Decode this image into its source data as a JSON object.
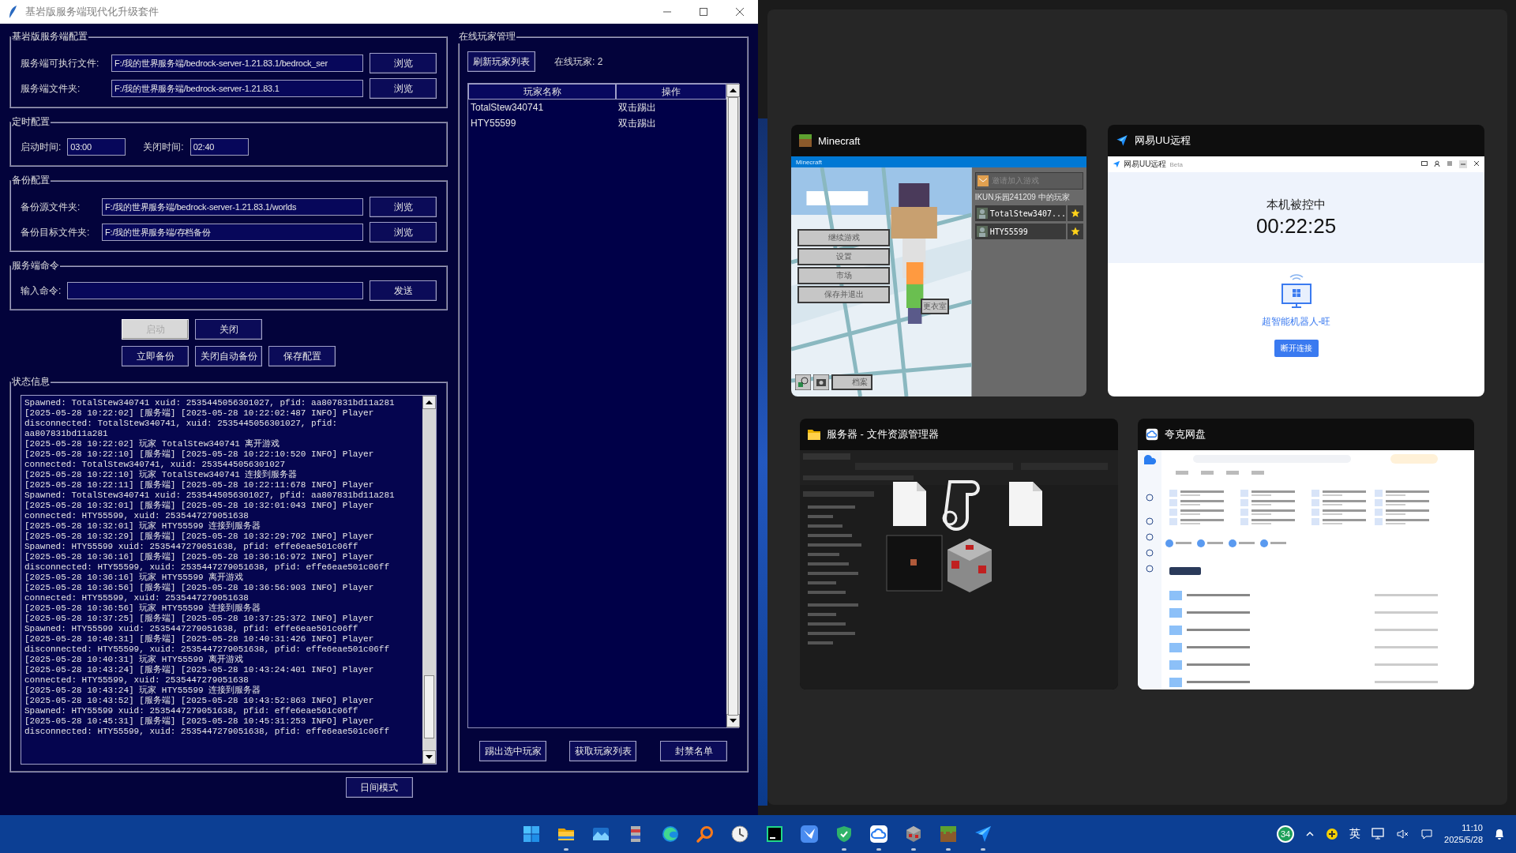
{
  "app_window": {
    "title": "基岩版服务端现代化升级套件",
    "server_config": {
      "title": "基岩版服务端配置",
      "fields": [
        {
          "label": "服务端可执行文件:",
          "value": "F:/我的世界服务端/bedrock-server-1.21.83.1/bedrock_ser",
          "button": "浏览"
        },
        {
          "label": "服务端文件夹:",
          "value": "F:/我的世界服务端/bedrock-server-1.21.83.1",
          "button": "浏览"
        }
      ]
    },
    "schedule": {
      "title": "定时配置",
      "fields": [
        {
          "label": "启动时间:",
          "value": "03:00"
        },
        {
          "label": "关闭时间:",
          "value": "02:40"
        }
      ]
    },
    "backup": {
      "title": "备份配置",
      "fields": [
        {
          "label": "备份源文件夹:",
          "value": "F:/我的世界服务端/bedrock-server-1.21.83.1/worlds",
          "button": "浏览"
        },
        {
          "label": "备份目标文件夹:",
          "value": "F:/我的世界服务端/存档备份",
          "button": "浏览"
        }
      ]
    },
    "command": {
      "title": "服务端命令",
      "label": "输入命令:",
      "button": "发送"
    },
    "actions": [
      {
        "label": "启动",
        "disabled": true
      },
      {
        "label": "关闭",
        "disabled": false
      },
      {
        "label": "立即备份",
        "disabled": false
      },
      {
        "label": "关闭自动备份",
        "disabled": false
      },
      {
        "label": "保存配置",
        "disabled": false
      }
    ],
    "status": {
      "title": "状态信息",
      "log": [
        "Spawned: TotalStew340741 xuid: 2535445056301027, pfid: aa807831bd11a281",
        "[2025-05-28 10:22:02] [服务端] [2025-05-28 10:22:02:487 INFO] Player",
        "disconnected: TotalStew340741, xuid: 2535445056301027, pfid:",
        "aa807831bd11a281",
        "[2025-05-28 10:22:02] 玩家 TotalStew340741 离开游戏",
        "[2025-05-28 10:22:10] [服务端] [2025-05-28 10:22:10:520 INFO] Player",
        "connected: TotalStew340741, xuid: 2535445056301027",
        "[2025-05-28 10:22:10] 玩家 TotalStew340741 连接到服务器",
        "[2025-05-28 10:22:11] [服务端] [2025-05-28 10:22:11:678 INFO] Player",
        "Spawned: TotalStew340741 xuid: 2535445056301027, pfid: aa807831bd11a281",
        "[2025-05-28 10:32:01] [服务端] [2025-05-28 10:32:01:043 INFO] Player",
        "connected: HTY55599, xuid: 2535447279051638",
        "[2025-05-28 10:32:01] 玩家 HTY55599 连接到服务器",
        "[2025-05-28 10:32:29] [服务端] [2025-05-28 10:32:29:702 INFO] Player",
        "Spawned: HTY55599 xuid: 2535447279051638, pfid: effe6eae501c06ff",
        "[2025-05-28 10:36:16] [服务端] [2025-05-28 10:36:16:972 INFO] Player",
        "disconnected: HTY55599, xuid: 2535447279051638, pfid: effe6eae501c06ff",
        "[2025-05-28 10:36:16] 玩家 HTY55599 离开游戏",
        "[2025-05-28 10:36:56] [服务端] [2025-05-28 10:36:56:903 INFO] Player",
        "connected: HTY55599, xuid: 2535447279051638",
        "[2025-05-28 10:36:56] 玩家 HTY55599 连接到服务器",
        "[2025-05-28 10:37:25] [服务端] [2025-05-28 10:37:25:372 INFO] Player",
        "Spawned: HTY55599 xuid: 2535447279051638, pfid: effe6eae501c06ff",
        "[2025-05-28 10:40:31] [服务端] [2025-05-28 10:40:31:426 INFO] Player",
        "disconnected: HTY55599, xuid: 2535447279051638, pfid: effe6eae501c06ff",
        "[2025-05-28 10:40:31] 玩家 HTY55599 离开游戏",
        "[2025-05-28 10:43:24] [服务端] [2025-05-28 10:43:24:401 INFO] Player",
        "connected: HTY55599, xuid: 2535447279051638",
        "[2025-05-28 10:43:24] 玩家 HTY55599 连接到服务器",
        "[2025-05-28 10:43:52] [服务端] [2025-05-28 10:43:52:863 INFO] Player",
        "Spawned: HTY55599 xuid: 2535447279051638, pfid: effe6eae501c06ff",
        "[2025-05-28 10:45:31] [服务端] [2025-05-28 10:45:31:253 INFO] Player",
        "disconnected: HTY55599, xuid: 2535447279051638, pfid: effe6eae501c06ff"
      ]
    },
    "theme_button": "日间模式",
    "players": {
      "title": "在线玩家管理",
      "refresh_button": "刷新玩家列表",
      "count": "在线玩家: 2",
      "columns": [
        "玩家名称",
        "操作"
      ],
      "rows": [
        {
          "name": "TotalStew340741",
          "action": "双击踢出",
          "selected": false
        },
        {
          "name": "HTY55599",
          "action": "双击踢出",
          "selected": false
        }
      ],
      "buttons": [
        "踢出选中玩家",
        "获取玩家列表",
        "封禁名单"
      ]
    }
  },
  "task_view": {
    "windows": [
      {
        "kind": "game",
        "title": "Minecraft",
        "bar_title": "Minecraft",
        "menu": [
          "继续游戏",
          "设置",
          "市场",
          "保存并退出"
        ],
        "wardrobe": "更衣室",
        "profile": "档案",
        "invite": "邀请加入游戏",
        "list_title": "IKUN乐园241209 中的玩家",
        "players": [
          "TotalStew3407...",
          "HTY55599"
        ]
      },
      {
        "kind": "remote",
        "title": "网易UU远程",
        "bar_title": "网易UU远程",
        "bar_badge": "Beta",
        "status": "本机被控中",
        "timer": "00:22:25",
        "device": "超智能机器人-旺",
        "button": "断开连接"
      },
      {
        "kind": "explorer",
        "title": "服务器 - 文件资源管理器"
      },
      {
        "kind": "cloud_drive",
        "title": "夸克网盘"
      }
    ]
  },
  "taskbar": {
    "apps": [
      {
        "kind": "start",
        "running": false
      },
      {
        "kind": "folder",
        "running": true
      },
      {
        "kind": "photos",
        "running": false
      },
      {
        "kind": "archive",
        "running": false
      },
      {
        "kind": "browser",
        "running": false
      },
      {
        "kind": "search",
        "running": false
      },
      {
        "kind": "clock",
        "running": false
      },
      {
        "kind": "ide",
        "running": false
      },
      {
        "kind": "bird",
        "running": false
      },
      {
        "kind": "shield",
        "running": true
      },
      {
        "kind": "cloud",
        "running": true
      },
      {
        "kind": "redstone",
        "running": true
      },
      {
        "kind": "grass",
        "running": true
      },
      {
        "kind": "uu",
        "running": true
      }
    ],
    "tray": {
      "badge": "34",
      "ime": "英",
      "time": "11:10",
      "date": "2025/5/28"
    }
  }
}
